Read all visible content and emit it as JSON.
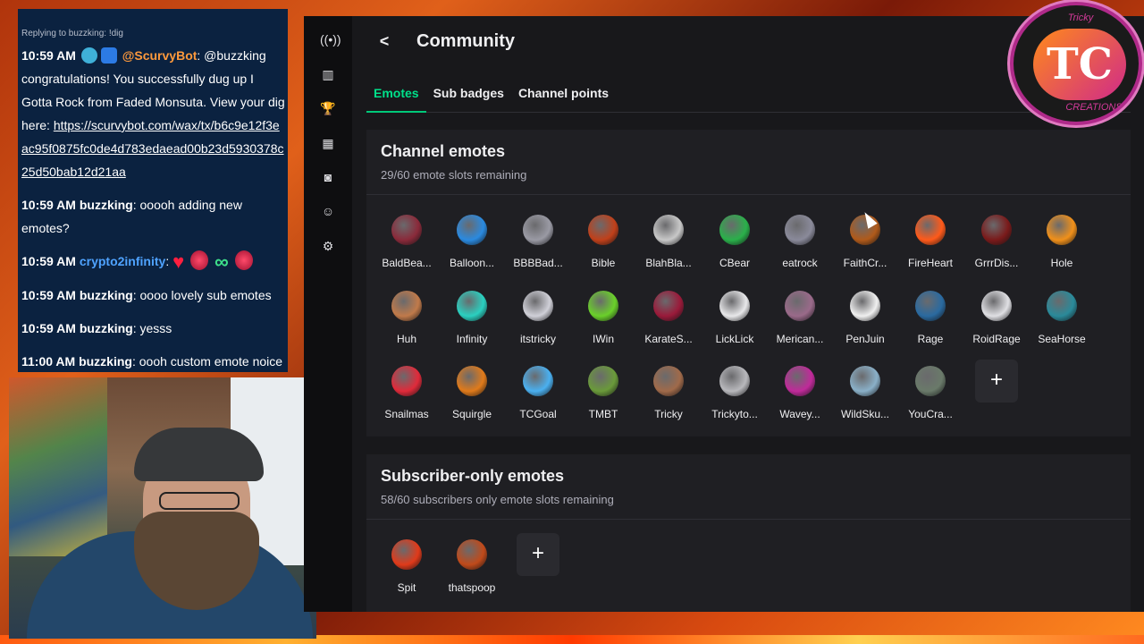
{
  "chat": {
    "reply_context": "Replying to buzzking: !dig",
    "messages": [
      {
        "time": "10:59 AM",
        "user": "@ScurvyBot",
        "text": ": @buzzking congratulations! You successfully dug up I Gotta Rock from Faded Monsuta. View your dig here:",
        "link": "https://scurvybot.com/wax/tx/b6c9e12f3eac95f0875fc0de4d783edaead00b23d5930378c25d50bab12d21aa"
      },
      {
        "time": "10:59 AM",
        "user": "buzzking",
        "text": ": ooooh adding new emotes?"
      },
      {
        "time": "10:59 AM",
        "user": "crypto2infinity",
        "text": ":"
      },
      {
        "time": "10:59 AM",
        "user": "buzzking",
        "text": ": oooo lovely sub emotes"
      },
      {
        "time": "10:59 AM",
        "user": "buzzking",
        "text": ": yesss"
      },
      {
        "time": "11:00 AM",
        "user": "buzzking",
        "text": ": oooh custom emote noice"
      }
    ]
  },
  "logo": {
    "top_text": "Tricky",
    "mark": "TC",
    "bottom_text": "CREATIONS"
  },
  "rail": {
    "icons": [
      "broadcast-icon",
      "stats-icon",
      "trophy-icon",
      "cake-icon",
      "camera-icon",
      "community-icon",
      "settings-icon"
    ]
  },
  "header": {
    "back_label": "<",
    "title": "Community"
  },
  "tabs": [
    {
      "label": "Emotes",
      "active": true
    },
    {
      "label": "Sub badges",
      "active": false
    },
    {
      "label": "Channel points",
      "active": false
    }
  ],
  "channel_emotes": {
    "title": "Channel emotes",
    "subtitle": "29/60 emote slots remaining",
    "add_label": "+",
    "items": [
      {
        "label": "BaldBea...",
        "color": "#8a2a3a"
      },
      {
        "label": "Balloon...",
        "color": "#2a8ae0"
      },
      {
        "label": "BBBBad...",
        "color": "#9a9aa4"
      },
      {
        "label": "Bible",
        "color": "#c0401a"
      },
      {
        "label": "BlahBla...",
        "color": "#c8c8c8"
      },
      {
        "label": "CBear",
        "color": "#2ab04a"
      },
      {
        "label": "eatrock",
        "color": "#8a8a9a"
      },
      {
        "label": "FaithCr...",
        "color": "#b05a1a"
      },
      {
        "label": "FireHeart",
        "color": "#ff5a1a"
      },
      {
        "label": "GrrrDis...",
        "color": "#7a1a1a"
      },
      {
        "label": "Hole",
        "color": "#f0901a"
      },
      {
        "label": "Huh",
        "color": "#c07a4a"
      },
      {
        "label": "Infinity",
        "color": "#2ad0c0"
      },
      {
        "label": "itstricky",
        "color": "#d0d0d8"
      },
      {
        "label": "IWin",
        "color": "#6ad02a"
      },
      {
        "label": "KarateS...",
        "color": "#9a1a3a"
      },
      {
        "label": "LickLick",
        "color": "#e8e8ea"
      },
      {
        "label": "Merican...",
        "color": "#9a6a8a"
      },
      {
        "label": "PenJuin",
        "color": "#f0f0f0"
      },
      {
        "label": "Rage",
        "color": "#2a6aa0"
      },
      {
        "label": "RoidRage",
        "color": "#e0e0e4"
      },
      {
        "label": "SeaHorse",
        "color": "#2a8a9a"
      },
      {
        "label": "Snailmas",
        "color": "#e02a3a"
      },
      {
        "label": "Squirgle",
        "color": "#e07a1a"
      },
      {
        "label": "TCGoal",
        "color": "#4ab0f0"
      },
      {
        "label": "TMBT",
        "color": "#6a9a3a"
      },
      {
        "label": "Tricky",
        "color": "#a06a4a"
      },
      {
        "label": "Trickyto...",
        "color": "#b8b8bc"
      },
      {
        "label": "Wavey...",
        "color": "#c02a9a"
      },
      {
        "label": "WildSku...",
        "color": "#8ab0c8"
      },
      {
        "label": "YouCra...",
        "color": "#6a7a6a"
      }
    ]
  },
  "subscriber_emotes": {
    "title": "Subscriber-only emotes",
    "subtitle": "58/60 subscribers only emote slots remaining",
    "add_label": "+",
    "items": [
      {
        "label": "Spit",
        "color": "#e03a1a"
      },
      {
        "label": "thatspoop",
        "color": "#c04a1a"
      }
    ]
  }
}
